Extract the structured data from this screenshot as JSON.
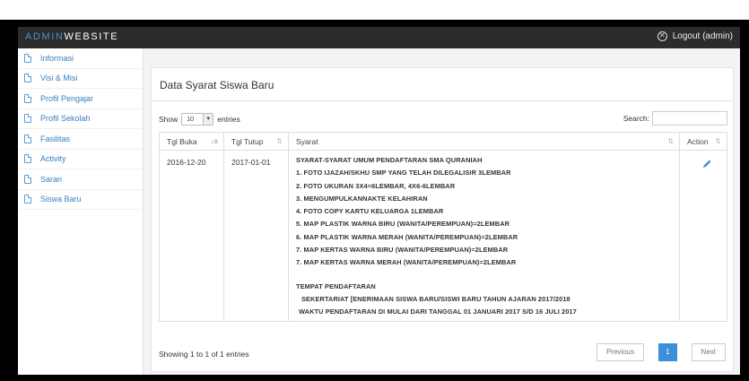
{
  "app": {
    "brand_prefix": "ADMIN",
    "brand_suffix": "WEBSITE",
    "logout_label": "Logout (admin)"
  },
  "sidebar": {
    "items": [
      {
        "label": "Informasi"
      },
      {
        "label": "Visi & Misi"
      },
      {
        "label": "Profil Pengajar"
      },
      {
        "label": "Profil Sekolah"
      },
      {
        "label": "Fasilitas"
      },
      {
        "label": "Activity"
      },
      {
        "label": "Saran"
      },
      {
        "label": "Siswa Baru"
      }
    ]
  },
  "panel": {
    "title": "Data Syarat Siswa Baru"
  },
  "controls": {
    "show_label": "Show",
    "entries_value": "10",
    "entries_label": "entries",
    "search_label": "Search:"
  },
  "table": {
    "headers": [
      "Tgl Buka",
      "Tgl Tutup",
      "Syarat",
      "Action"
    ],
    "row": {
      "tgl_buka": "2016-12-20",
      "tgl_tutup": "2017-01-01",
      "syarat_lines": [
        "SYARAT-SYARAT UMUM PENDAFTARAN SMA QURANIAH",
        "1. FOTO IJAZAH/SKHU SMP YANG TELAH DILEGALISIR 3LEMBAR",
        "2. FOTO UKURAN 3X4=6LEMBAR, 4X6-6LEMBAR",
        "3. MENGUMPULKANNAKTE KELAHIRAN",
        "4. FOTO COPY KARTU KELUARGA 1LEMBAR",
        "5. MAP PLASTIK WARNA BIRU (WANITA/PEREMPUAN)=2LEMBAR",
        "6. MAP PLASTIK WARNA MERAH (WANITA/PEREMPUAN)=2LEMBAR",
        "7. MAP KERTAS WARNA BIRU (WANITA/PEREMPUAN)=2LEMBAR",
        "7. MAP KERTAS WARNA MERAH (WANITA/PEREMPUAN)=2LEMBAR",
        "",
        "TEMPAT PENDAFTARAN",
        "SEKERTARIAT [ENERIMAAN SISWA BARU/SISWI BARU TAHUN AJARAN 2017/2018",
        "WAKTU PENDAFTARAN DI MULAI DARI TANGGAL 01 JANUARI 2017 S/D 16 JULI 2017"
      ],
      "action_icon": "pencil-icon"
    }
  },
  "footer": {
    "info": "Showing 1 to 1 of 1 entries",
    "prev": "Previous",
    "page": "1",
    "next": "Next"
  },
  "colors": {
    "navbar": "#2c2c2c",
    "accent": "#3b8fdb",
    "link": "#3a7ebf"
  }
}
